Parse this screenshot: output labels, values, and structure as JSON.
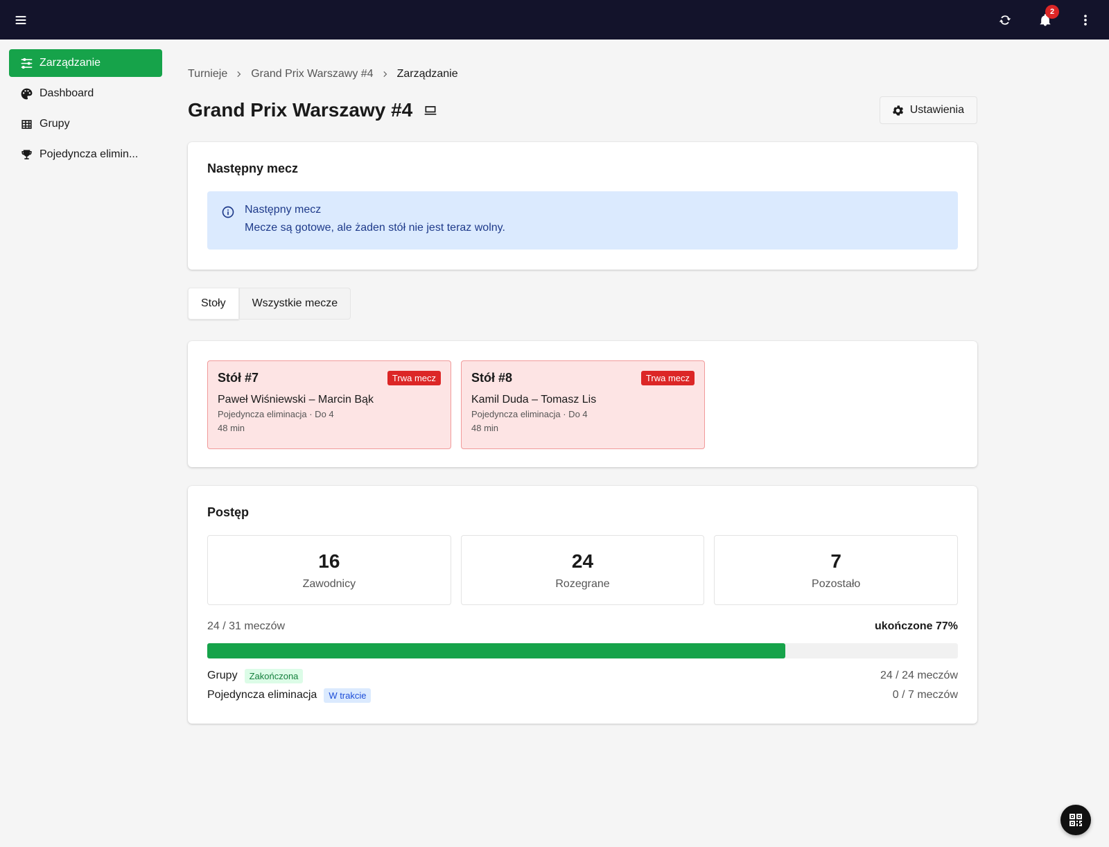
{
  "topbar": {
    "notifications_count": "2",
    "bg_color": "#13132b"
  },
  "sidebar": {
    "items": [
      {
        "label": "Zarządzanie",
        "icon": "sliders-icon",
        "active": true
      },
      {
        "label": "Dashboard",
        "icon": "palette-icon",
        "active": false
      },
      {
        "label": "Grupy",
        "icon": "grid-table-icon",
        "active": false
      },
      {
        "label": "Pojedyncza elimin...",
        "icon": "trophy-icon",
        "active": false
      }
    ]
  },
  "breadcrumb": {
    "items": [
      "Turnieje",
      "Grand Prix Warszawy #4",
      "Zarządzanie"
    ]
  },
  "page": {
    "title": "Grand Prix Warszawy #4",
    "settings_label": "Ustawienia"
  },
  "next_match": {
    "heading": "Następny mecz",
    "info_title": "Następny mecz",
    "info_text": "Mecze są gotowe, ale żaden stół nie jest teraz wolny."
  },
  "tabs": {
    "items": [
      "Stoły",
      "Wszystkie mecze"
    ],
    "active": "Stoły"
  },
  "tables": [
    {
      "name": "Stół #7",
      "status": "Trwa mecz",
      "players": "Paweł Wiśniewski – Marcin Bąk",
      "meta": "Pojedyncza eliminacja · Do 4",
      "time": "48 min"
    },
    {
      "name": "Stół #8",
      "status": "Trwa mecz",
      "players": "Kamil Duda – Tomasz Lis",
      "meta": "Pojedyncza eliminacja · Do 4",
      "time": "48 min"
    }
  ],
  "progress": {
    "heading": "Postęp",
    "stats": [
      {
        "value": "16",
        "label": "Zawodnicy"
      },
      {
        "value": "24",
        "label": "Rozegrane"
      },
      {
        "value": "7",
        "label": "Pozostało"
      }
    ],
    "matches_text": "24 / 31 meczów",
    "percent_text": "ukończone 77%",
    "percent": 77,
    "phases": [
      {
        "name": "Grupy",
        "badge": "Zakończona",
        "count": "24 / 24 meczów"
      },
      {
        "name": "Pojedyncza eliminacja",
        "badge": "W trakcie",
        "count": "0 / 7 meczów"
      }
    ]
  },
  "colors": {
    "accent": "#16a34a",
    "danger": "#dc2626",
    "info_bg": "#dbeafe"
  }
}
